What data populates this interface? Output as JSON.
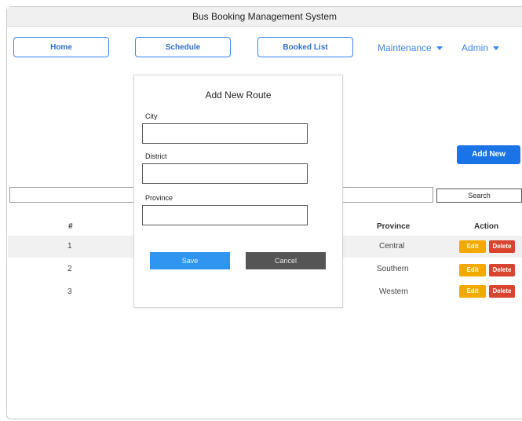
{
  "window": {
    "title": "Bus Booking Management System"
  },
  "nav": {
    "home": "Home",
    "schedule": "Schedule",
    "booked_list": "Booked List",
    "maintenance": "Maintenance",
    "admin": "Admin"
  },
  "actions": {
    "add_new": "Add New",
    "search": "Search"
  },
  "table": {
    "headers": {
      "num": "#",
      "province": "Province",
      "action": "Action"
    },
    "rows": [
      {
        "num": "1",
        "province": "Central"
      },
      {
        "num": "2",
        "province": "Southern"
      },
      {
        "num": "3",
        "province": "Western"
      }
    ],
    "edit_label": "Edit",
    "delete_label": "Delete"
  },
  "modal": {
    "title": "Add New Route",
    "city_label": "City",
    "district_label": "District",
    "province_label": "Province",
    "save_label": "Save",
    "cancel_label": "Cancel"
  },
  "colors": {
    "primary": "#1b73e8",
    "nav_border": "#3a86f0",
    "edit": "#f2a900",
    "delete": "#d9432f",
    "save": "#2f95f0",
    "cancel": "#555555"
  }
}
